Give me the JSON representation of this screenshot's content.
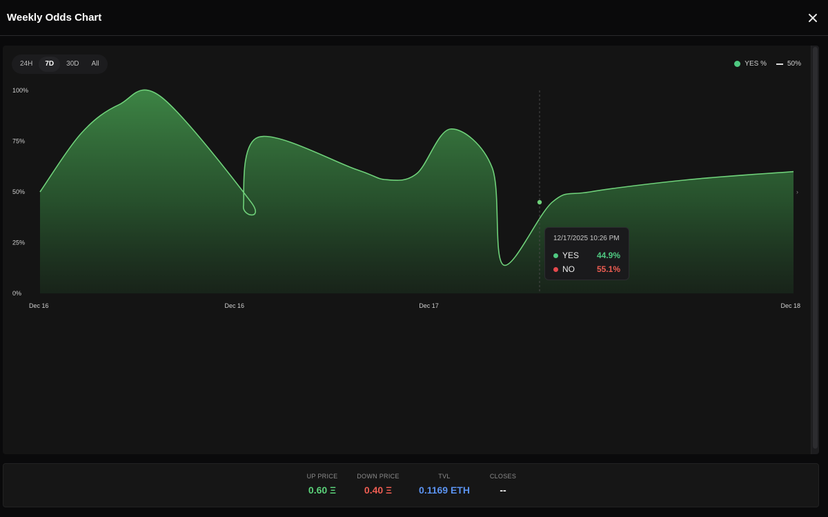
{
  "modal": {
    "title": "Weekly Odds Chart",
    "close_icon": "close-icon"
  },
  "tabs": [
    {
      "label": "24H",
      "active": false
    },
    {
      "label": "7D",
      "active": true
    },
    {
      "label": "30D",
      "active": false
    },
    {
      "label": "All",
      "active": false
    }
  ],
  "legend": {
    "yes_label": "YES %",
    "midline_label": "50%"
  },
  "chart_data": {
    "type": "area",
    "title": "",
    "xlabel": "",
    "ylabel": "",
    "x_tick_labels": [
      "Dec 16",
      "Dec 16",
      "Dec 17",
      "Dec 18"
    ],
    "y_tick_labels": [
      "100%",
      "75%",
      "50%",
      "25%",
      "0%"
    ],
    "ylim": [
      0,
      100
    ],
    "grid": false,
    "legend_position": "top-right",
    "series": [
      {
        "name": "YES %",
        "color": "#6fd17a",
        "x": [
          0,
          0.055,
          0.105,
          0.16,
          0.28,
          0.27,
          0.29,
          0.42,
          0.46,
          0.5,
          0.545,
          0.6,
          0.615,
          0.68,
          0.73,
          0.86,
          1.0
        ],
        "values": [
          50,
          79,
          93,
          97,
          45,
          43,
          77,
          61,
          56,
          59,
          81,
          62,
          14,
          45,
          50,
          56,
          60
        ]
      }
    ],
    "reference_line": {
      "value": 50,
      "label": "50%",
      "style": "dashed"
    },
    "hover": {
      "x": 0.663,
      "date": "12/17/2025 10:26 PM",
      "yes_label": "YES",
      "yes_value": "44.9%",
      "no_label": "NO",
      "no_value": "55.1%",
      "yes_color": "#4fc981",
      "no_color": "#e5484d"
    }
  },
  "stats": [
    {
      "label": "UP PRICE",
      "value": "0.60 Ξ",
      "color": "#5bd27a"
    },
    {
      "label": "DOWN PRICE",
      "value": "0.40 Ξ",
      "color": "#ee5d52"
    },
    {
      "label": "TVL",
      "value": "0.1169 ETH",
      "color": "#5b93f0"
    },
    {
      "label": "CLOSES",
      "value": "--",
      "color": "#ffffff"
    }
  ]
}
